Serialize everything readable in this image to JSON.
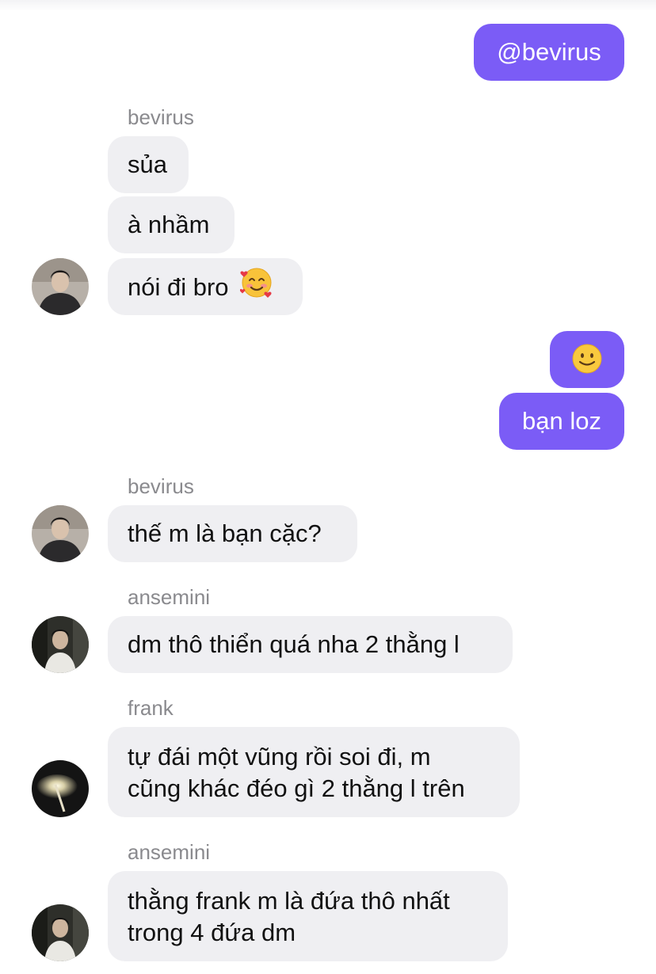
{
  "messages": {
    "m1": {
      "text": "@bevirus"
    },
    "s1": {
      "name": "bevirus"
    },
    "m2": {
      "text": "sủa"
    },
    "m3": {
      "text": "à nhầm"
    },
    "m4": {
      "text": "nói đi bro",
      "emoji": "smiling-face-with-hearts"
    },
    "m5": {
      "emoji": "slightly-smiling-face"
    },
    "m6": {
      "text": "bạn loz"
    },
    "s2": {
      "name": "bevirus"
    },
    "m7": {
      "text": "thế m là bạn cặc?"
    },
    "s3": {
      "name": "ansemini"
    },
    "m8": {
      "text": "dm thô thiển quá nha 2 thằng l"
    },
    "s4": {
      "name": "frank"
    },
    "m9": {
      "lines": [
        "tự đái một vũng rồi soi đi, m",
        "cũng khác đéo gì 2 thằng l trên"
      ]
    },
    "s5": {
      "name": "ansemini"
    },
    "m10": {
      "lines": [
        "thằng frank m là đứa thô nhất",
        "trong 4 đứa dm"
      ]
    }
  },
  "colors": {
    "outgoing_bubble": "#7b5cf6",
    "incoming_bubble": "#efeff2",
    "sender_name": "#8a8a8e"
  }
}
